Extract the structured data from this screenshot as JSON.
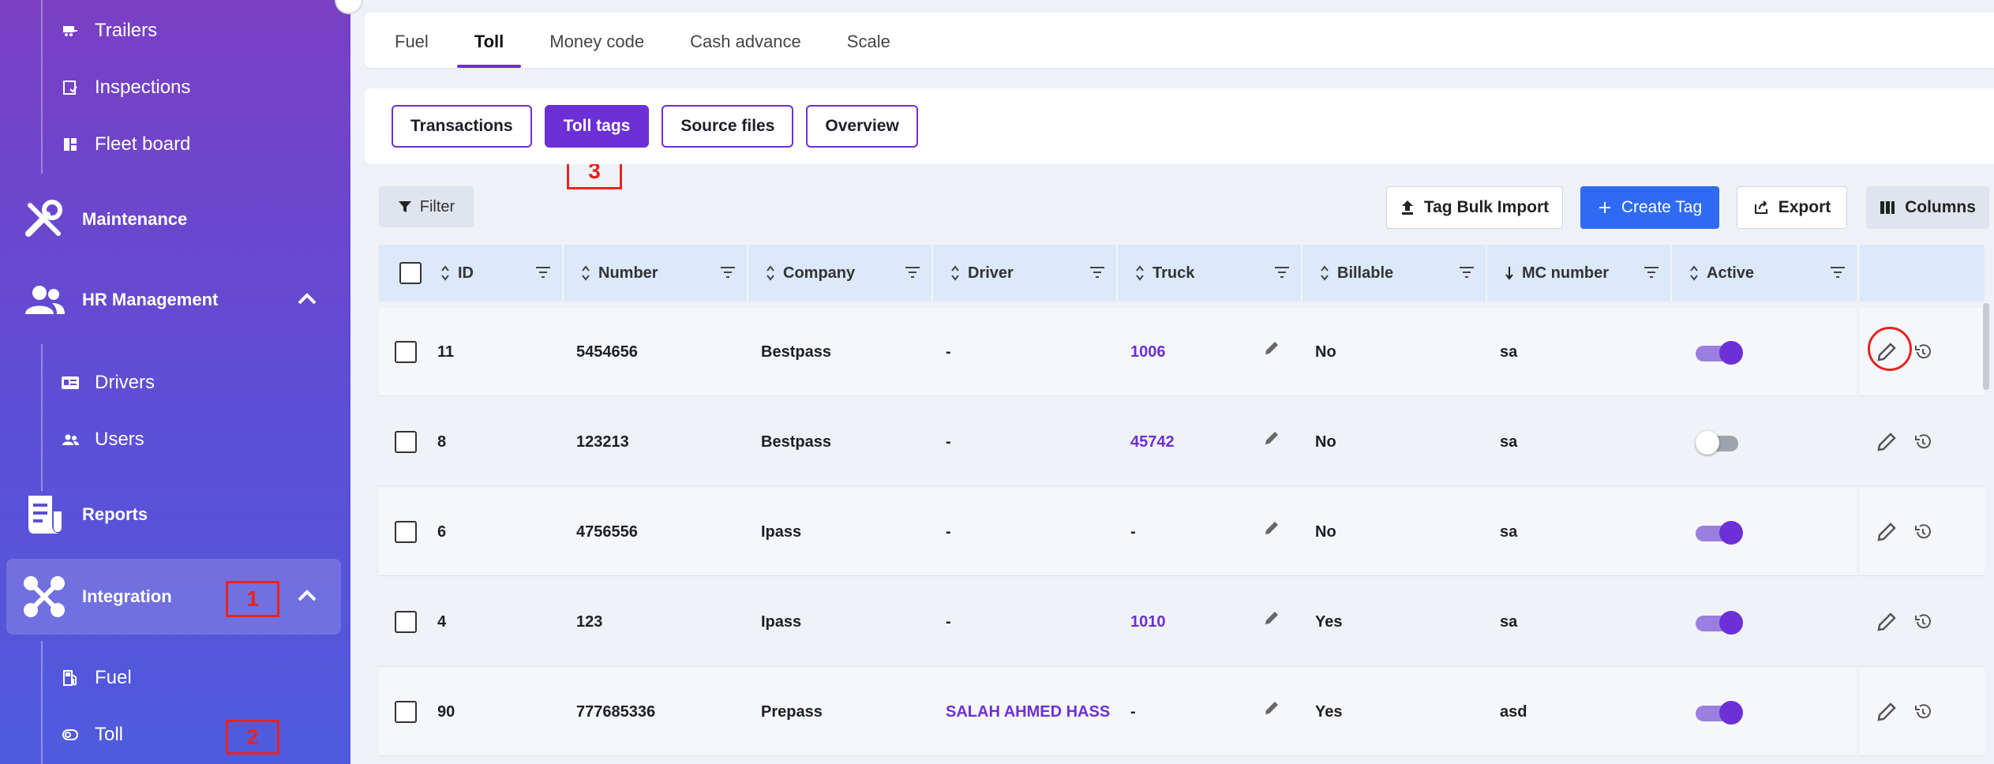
{
  "sidebar": {
    "top_items": [
      {
        "label": "Trailers",
        "icon": "trailer-icon"
      },
      {
        "label": "Inspections",
        "icon": "inspection-icon"
      },
      {
        "label": "Fleet board",
        "icon": "dashboard-icon"
      }
    ],
    "maintenance": {
      "label": "Maintenance",
      "icon": "tools-icon"
    },
    "hr": {
      "label": "HR Management",
      "icon": "people-icon"
    },
    "hr_items": [
      {
        "label": "Drivers",
        "icon": "id-card-icon"
      },
      {
        "label": "Users",
        "icon": "users-icon"
      }
    ],
    "reports": {
      "label": "Reports",
      "icon": "report-icon"
    },
    "integration": {
      "label": "Integration",
      "icon": "integration-icon"
    },
    "integration_items": [
      {
        "label": "Fuel",
        "icon": "fuel-icon"
      },
      {
        "label": "Toll",
        "icon": "toll-icon"
      }
    ]
  },
  "annotations": {
    "a1": "1",
    "a2": "2",
    "a3": "3"
  },
  "tabs": [
    "Fuel",
    "Toll",
    "Money code",
    "Cash advance",
    "Scale"
  ],
  "active_tab": "Toll",
  "subtabs": [
    "Transactions",
    "Toll tags",
    "Source files",
    "Overview"
  ],
  "active_subtab": "Toll tags",
  "toolbar": {
    "filter": "Filter",
    "bulk_import": "Tag Bulk Import",
    "create": "Create Tag",
    "export": "Export",
    "columns": "Columns"
  },
  "table": {
    "columns": [
      "ID",
      "Number",
      "Company",
      "Driver",
      "Truck",
      "Billable",
      "MC number",
      "Active"
    ],
    "rows": [
      {
        "id": "11",
        "number": "5454656",
        "company": "Bestpass",
        "driver": "-",
        "truck": "1006",
        "billable": "No",
        "mc": "sa",
        "active": true
      },
      {
        "id": "8",
        "number": "123213",
        "company": "Bestpass",
        "driver": "-",
        "truck": "45742",
        "billable": "No",
        "mc": "sa",
        "active": false
      },
      {
        "id": "6",
        "number": "4756556",
        "company": "Ipass",
        "driver": "-",
        "truck": "-",
        "billable": "No",
        "mc": "sa",
        "active": true
      },
      {
        "id": "4",
        "number": "123",
        "company": "Ipass",
        "driver": "-",
        "truck": "1010",
        "billable": "Yes",
        "mc": "sa",
        "active": true
      },
      {
        "id": "90",
        "number": "777685336",
        "company": "Prepass",
        "driver": "SALAH AHMED HASS",
        "truck": "-",
        "billable": "Yes",
        "mc": "asd",
        "active": true
      }
    ]
  },
  "colors": {
    "accent": "#6d2fd6",
    "primary_button": "#2f6bf2",
    "annotation": "#e52421"
  }
}
